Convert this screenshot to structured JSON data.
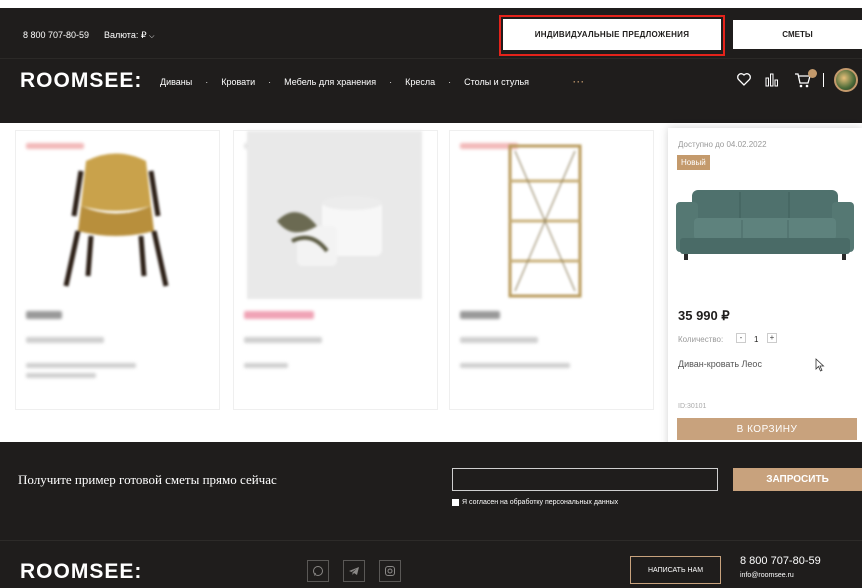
{
  "header": {
    "phone": "8 800 707-80-59",
    "currency_label": "Валюта: ₽",
    "offers_button": "ИНДИВИДУАЛЬНЫЕ ПРЕДЛОЖЕНИЯ",
    "estimates_button": "СМЕТЫ",
    "logo": "ROOMSEE:",
    "nav": [
      "Диваны",
      "Кровати",
      "Мебель для хранения",
      "Кресла",
      "Столы и стулья"
    ],
    "more": "···"
  },
  "featured": {
    "available_until": "Доступно до 04.02.2022",
    "badge": "Новый",
    "price": "35 990 ₽",
    "quantity_label": "Количество:",
    "quantity_minus": "-",
    "quantity_value": "1",
    "quantity_plus": "+",
    "name": "Диван-кровать Леос",
    "id": "ID:30101",
    "add_to_cart": "В КОРЗИНУ"
  },
  "cta": {
    "text": "Получите пример готовой сметы прямо сейчас",
    "input_placeholder": "",
    "consent": "Я согласен на обработку персональных данных",
    "request_button": "ЗАПРОСИТЬ"
  },
  "footer": {
    "logo": "ROOMSEE:",
    "write_button": "НАПИСАТЬ НАМ",
    "phone": "8 800 707-80-59",
    "email": "info@roomsee.ru"
  },
  "icons": {
    "heart": "heart-icon",
    "stats": "stats-icon",
    "cart": "cart-icon",
    "whatsapp": "whatsapp-icon",
    "telegram": "telegram-icon",
    "instagram": "instagram-icon"
  },
  "colors": {
    "dark": "#1f1d1c",
    "accent": "#c8a27d",
    "highlight": "#e4231b"
  }
}
